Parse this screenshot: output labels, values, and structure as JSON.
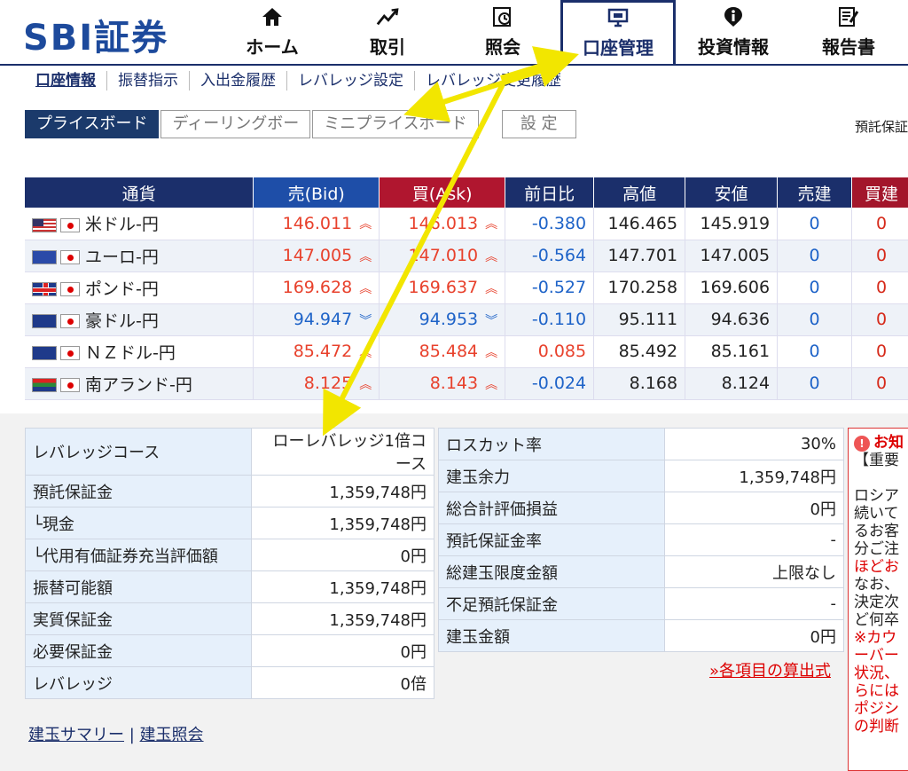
{
  "brand": {
    "logo": "SBI証券"
  },
  "nav": [
    {
      "label": "ホーム",
      "icon": "home-icon"
    },
    {
      "label": "取引",
      "icon": "trade-chart-icon"
    },
    {
      "label": "照会",
      "icon": "inquiry-clock-icon"
    },
    {
      "label": "口座管理",
      "icon": "monitor-icon",
      "active": true
    },
    {
      "label": "投資情報",
      "icon": "info-icon"
    },
    {
      "label": "報告書",
      "icon": "report-icon"
    }
  ],
  "subnav": [
    "口座情報",
    "振替指示",
    "入出金履歴",
    "レバレッジ設定",
    "レバレッジ変更履歴"
  ],
  "tabs": [
    "プライスボード",
    "ディーリングボー",
    "ミニプライスボード",
    "設 定"
  ],
  "deposit_label": "預託保証",
  "rates": {
    "headers": [
      "通貨",
      "売(Bid)",
      "買(Ask)",
      "前日比",
      "高値",
      "安値",
      "売建",
      "買建"
    ],
    "rows": [
      {
        "pair": "米ドル-円",
        "flag": "us",
        "bid": "146.011",
        "ask": "146.013",
        "dir": "up",
        "chg": "-0.380",
        "chg_dir": "down",
        "high": "146.465",
        "low": "145.919",
        "sell": "0",
        "buy": "0"
      },
      {
        "pair": "ユーロ-円",
        "flag": "eu",
        "bid": "147.005",
        "ask": "147.010",
        "dir": "up",
        "chg": "-0.564",
        "chg_dir": "down",
        "high": "147.701",
        "low": "147.005",
        "sell": "0",
        "buy": "0"
      },
      {
        "pair": "ポンド-円",
        "flag": "gb",
        "bid": "169.628",
        "ask": "169.637",
        "dir": "up",
        "chg": "-0.527",
        "chg_dir": "down",
        "high": "170.258",
        "low": "169.606",
        "sell": "0",
        "buy": "0"
      },
      {
        "pair": "豪ドル-円",
        "flag": "au",
        "bid": "94.947",
        "ask": "94.953",
        "dir": "down",
        "chg": "-0.110",
        "chg_dir": "down",
        "high": "95.111",
        "low": "94.636",
        "sell": "0",
        "buy": "0"
      },
      {
        "pair": "ＮＺドル-円",
        "flag": "nz",
        "bid": "85.472",
        "ask": "85.484",
        "dir": "up",
        "chg": "0.085",
        "chg_dir": "up",
        "high": "85.492",
        "low": "85.161",
        "sell": "0",
        "buy": "0"
      },
      {
        "pair": "南アランド-円",
        "flag": "za",
        "bid": "8.125",
        "ask": "8.143",
        "dir": "up",
        "chg": "-0.024",
        "chg_dir": "down",
        "high": "8.168",
        "low": "8.124",
        "sell": "0",
        "buy": "0"
      }
    ]
  },
  "account_left": [
    {
      "label": "レバレッジコース",
      "value": "ローレバレッジ1倍コース"
    },
    {
      "label": "預託保証金",
      "value": "1,359,748円"
    },
    {
      "label": "└現金",
      "value": "1,359,748円"
    },
    {
      "label": "└代用有価証券充当評価額",
      "value": "0円"
    },
    {
      "label": "振替可能額",
      "value": "1,359,748円"
    },
    {
      "label": "実質保証金",
      "value": "1,359,748円"
    },
    {
      "label": "必要保証金",
      "value": "0円"
    },
    {
      "label": "レバレッジ",
      "value": "0倍"
    }
  ],
  "account_right": [
    {
      "label": "ロスカット率",
      "value": "30%"
    },
    {
      "label": "建玉余力",
      "value": "1,359,748円"
    },
    {
      "label": "総合計評価損益",
      "value": "0円"
    },
    {
      "label": "預託保証金率",
      "value": "-"
    },
    {
      "label": "総建玉限度金額",
      "value": "上限なし"
    },
    {
      "label": "不足預託保証金",
      "value": "-"
    },
    {
      "label": "建玉金額",
      "value": "0円"
    }
  ],
  "formula_link": "»各項目の算出式",
  "bottom_links": {
    "summary": "建玉サマリー",
    "separator": "|",
    "inquiry": "建玉照会"
  },
  "notice": {
    "title": "お知",
    "lines": [
      "【重要",
      "",
      "ロシア",
      "続いて",
      "るお客",
      "分ご注",
      "ほどお",
      "なお、",
      "決定次",
      "ど何卒",
      "※カウ",
      "ーバー",
      "状況、",
      "らには",
      "ポジシ",
      "の判断"
    ],
    "red_lines": [
      6,
      10,
      11,
      12,
      13,
      14,
      15
    ]
  },
  "colors": {
    "brand_blue": "#1b2f6b",
    "up": "#e8412c",
    "down": "#1e63c8",
    "arrow": "#f2e600"
  }
}
